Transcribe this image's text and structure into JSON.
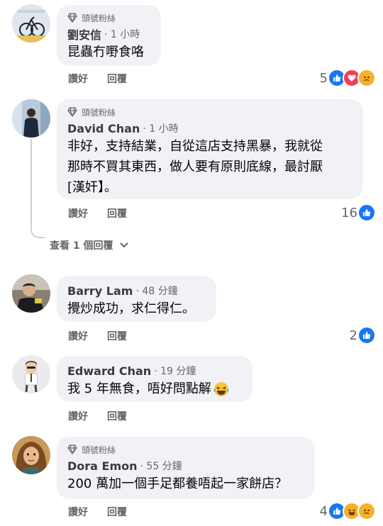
{
  "comments": [
    {
      "badge": "頭號粉絲",
      "name": "劉安信",
      "time": "· 1 小時",
      "text": [
        "昆蟲冇嘢食咯"
      ],
      "actions": [
        "讚好",
        "回覆"
      ],
      "reaction_count": "5",
      "reaction_icons": [
        "like-icon",
        "love-icon",
        "sad-icon"
      ]
    },
    {
      "badge": "頭號粉絲",
      "name": "David Chan",
      "time": "· 1 小時",
      "text": [
        "非好，支持結業，自從這店支持黑暴，我就從",
        "那時不買其東西，做人要有原則底線，最討厭",
        "[漢奸】。"
      ],
      "actions": [
        "讚好",
        "回覆"
      ],
      "reaction_count": "16",
      "reaction_icons": [
        "like-icon"
      ],
      "view_replies": "查看 1 個回覆"
    },
    {
      "name": "Barry Lam",
      "time": "· 48 分鐘",
      "text": [
        "攪炒成功，求仁得仁。"
      ],
      "actions": [
        "讚好",
        "回覆"
      ],
      "reaction_count": "2",
      "reaction_icons": [
        "like-icon"
      ]
    },
    {
      "name": "Edward Chan",
      "time": "· 19 分鐘",
      "text": [
        "我 5 年無食，唔好問點解"
      ],
      "emoji": "laughing-tears-emoji",
      "actions": [
        "讚好",
        "回覆"
      ]
    },
    {
      "badge": "頭號粉絲",
      "name": "Dora Emon",
      "time": "· 55 分鐘",
      "text": [
        "200 萬加一個手足都養唔起一家餅店？"
      ],
      "actions": [
        "讚好",
        "回覆"
      ],
      "reaction_count": "4",
      "reaction_icons": [
        "like-icon",
        "haha-icon",
        "sad-icon"
      ]
    }
  ]
}
